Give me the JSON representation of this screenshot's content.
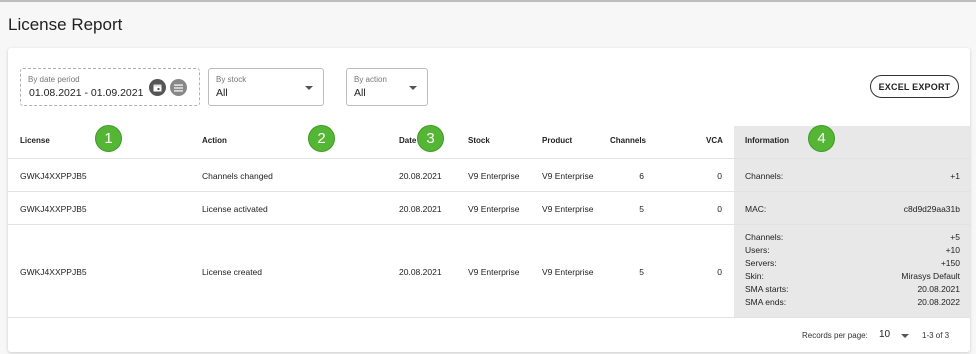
{
  "page": {
    "title": "License Report"
  },
  "filters": {
    "date": {
      "label": "By date period",
      "value": "01.08.2021 - 01.09.2021"
    },
    "stock": {
      "label": "By stock",
      "value": "All"
    },
    "action": {
      "label": "By action",
      "value": "All"
    }
  },
  "toolbar": {
    "excel_export": "EXCEL EXPORT"
  },
  "table": {
    "headers": {
      "license": "License",
      "action": "Action",
      "date": "Date",
      "stock": "Stock",
      "product": "Product",
      "channels": "Channels",
      "vca": "VCA",
      "information": "Information"
    },
    "rows": [
      {
        "license": "GWKJ4XXPPJB5",
        "action": "Channels changed",
        "date": "20.08.2021",
        "stock": "V9 Enterprise",
        "product": "V9 Enterprise",
        "channels": "6",
        "vca": "0",
        "information": [
          {
            "key": "Channels:",
            "value": "+1"
          }
        ]
      },
      {
        "license": "GWKJ4XXPPJB5",
        "action": "License activated",
        "date": "20.08.2021",
        "stock": "V9 Enterprise",
        "product": "V9 Enterprise",
        "channels": "5",
        "vca": "0",
        "information": [
          {
            "key": "MAC:",
            "value": "c8d9d29aa31b"
          }
        ]
      },
      {
        "license": "GWKJ4XXPPJB5",
        "action": "License created",
        "date": "20.08.2021",
        "stock": "V9 Enterprise",
        "product": "V9 Enterprise",
        "channels": "5",
        "vca": "0",
        "information": [
          {
            "key": "Channels:",
            "value": "+5"
          },
          {
            "key": "Users:",
            "value": "+10"
          },
          {
            "key": "Servers:",
            "value": "+150"
          },
          {
            "key": "Skin:",
            "value": "Mirasys Default"
          },
          {
            "key": "SMA starts:",
            "value": "20.08.2021"
          },
          {
            "key": "SMA ends:",
            "value": "20.08.2022"
          }
        ]
      }
    ]
  },
  "markers": [
    "1",
    "2",
    "3",
    "4"
  ],
  "pagination": {
    "records_per_page_label": "Records per page:",
    "records_per_page": "10",
    "range": "1-3 of 3"
  },
  "colors": {
    "marker": "#55b535",
    "info_column": "#e8e8e8",
    "accent_text": "#222222"
  }
}
